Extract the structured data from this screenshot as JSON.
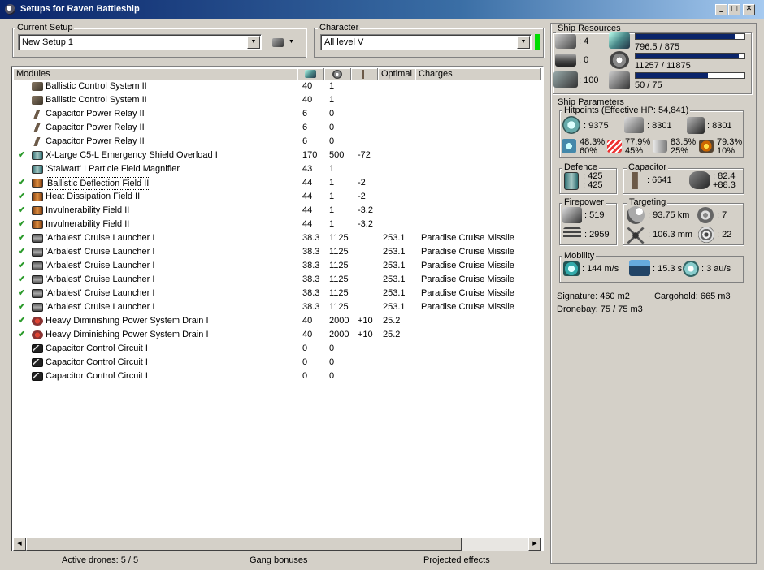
{
  "window": {
    "title": "Setups for Raven Battleship",
    "buttons": [
      "_",
      "□",
      "✕"
    ]
  },
  "current_setup": {
    "label": "Current Setup",
    "value": "New Setup 1"
  },
  "character": {
    "label": "Character",
    "value": "All level V",
    "status_color": "#00dd00"
  },
  "modules_table": {
    "headers": [
      "Modules",
      "cpu-icon",
      "powergrid-icon",
      "capacitor-icon",
      "Optimal",
      "Charges"
    ],
    "rows": [
      {
        "checked": false,
        "icon": "ic-bcs",
        "name": "Ballistic Control System II",
        "cpu": "40",
        "pg": "1",
        "cap": "",
        "optimal": "",
        "charges": ""
      },
      {
        "checked": false,
        "icon": "ic-bcs",
        "name": "Ballistic Control System II",
        "cpu": "40",
        "pg": "1",
        "cap": "",
        "optimal": "",
        "charges": ""
      },
      {
        "checked": false,
        "icon": "ic-cpr",
        "name": "Capacitor Power Relay II",
        "cpu": "6",
        "pg": "0",
        "cap": "",
        "optimal": "",
        "charges": ""
      },
      {
        "checked": false,
        "icon": "ic-cpr",
        "name": "Capacitor Power Relay II",
        "cpu": "6",
        "pg": "0",
        "cap": "",
        "optimal": "",
        "charges": ""
      },
      {
        "checked": false,
        "icon": "ic-cpr",
        "name": "Capacitor Power Relay II",
        "cpu": "6",
        "pg": "0",
        "cap": "",
        "optimal": "",
        "charges": ""
      },
      {
        "checked": true,
        "icon": "ic-shield",
        "name": "X-Large C5-L Emergency Shield Overload I",
        "cpu": "170",
        "pg": "500",
        "cap": "-72",
        "optimal": "",
        "charges": ""
      },
      {
        "checked": false,
        "icon": "ic-shield",
        "name": "'Stalwart' I Particle Field Magnifier",
        "cpu": "43",
        "pg": "1",
        "cap": "",
        "optimal": "",
        "charges": ""
      },
      {
        "checked": true,
        "icon": "ic-armor",
        "name": "Ballistic Deflection Field II",
        "cpu": "44",
        "pg": "1",
        "cap": "-2",
        "optimal": "",
        "charges": "",
        "focused": true
      },
      {
        "checked": true,
        "icon": "ic-armor",
        "name": "Heat Dissipation Field II",
        "cpu": "44",
        "pg": "1",
        "cap": "-2",
        "optimal": "",
        "charges": ""
      },
      {
        "checked": true,
        "icon": "ic-armor",
        "name": "Invulnerability Field II",
        "cpu": "44",
        "pg": "1",
        "cap": "-3.2",
        "optimal": "",
        "charges": ""
      },
      {
        "checked": true,
        "icon": "ic-armor",
        "name": "Invulnerability Field II",
        "cpu": "44",
        "pg": "1",
        "cap": "-3.2",
        "optimal": "",
        "charges": ""
      },
      {
        "checked": true,
        "icon": "ic-launch",
        "name": "'Arbalest' Cruise Launcher I",
        "cpu": "38.3",
        "pg": "1125",
        "cap": "",
        "optimal": "253.1",
        "charges": "Paradise Cruise Missile"
      },
      {
        "checked": true,
        "icon": "ic-launch",
        "name": "'Arbalest' Cruise Launcher I",
        "cpu": "38.3",
        "pg": "1125",
        "cap": "",
        "optimal": "253.1",
        "charges": "Paradise Cruise Missile"
      },
      {
        "checked": true,
        "icon": "ic-launch",
        "name": "'Arbalest' Cruise Launcher I",
        "cpu": "38.3",
        "pg": "1125",
        "cap": "",
        "optimal": "253.1",
        "charges": "Paradise Cruise Missile"
      },
      {
        "checked": true,
        "icon": "ic-launch",
        "name": "'Arbalest' Cruise Launcher I",
        "cpu": "38.3",
        "pg": "1125",
        "cap": "",
        "optimal": "253.1",
        "charges": "Paradise Cruise Missile"
      },
      {
        "checked": true,
        "icon": "ic-launch",
        "name": "'Arbalest' Cruise Launcher I",
        "cpu": "38.3",
        "pg": "1125",
        "cap": "",
        "optimal": "253.1",
        "charges": "Paradise Cruise Missile"
      },
      {
        "checked": true,
        "icon": "ic-launch",
        "name": "'Arbalest' Cruise Launcher I",
        "cpu": "38.3",
        "pg": "1125",
        "cap": "",
        "optimal": "253.1",
        "charges": "Paradise Cruise Missile"
      },
      {
        "checked": true,
        "icon": "ic-drain",
        "name": "Heavy Diminishing Power System Drain I",
        "cpu": "40",
        "pg": "2000",
        "cap": "+10",
        "optimal": "25.2",
        "charges": ""
      },
      {
        "checked": true,
        "icon": "ic-drain",
        "name": "Heavy Diminishing Power System Drain I",
        "cpu": "40",
        "pg": "2000",
        "cap": "+10",
        "optimal": "25.2",
        "charges": ""
      },
      {
        "checked": false,
        "icon": "ic-ccc",
        "name": "Capacitor Control Circuit I",
        "cpu": "0",
        "pg": "0",
        "cap": "",
        "optimal": "",
        "charges": ""
      },
      {
        "checked": false,
        "icon": "ic-ccc",
        "name": "Capacitor Control Circuit I",
        "cpu": "0",
        "pg": "0",
        "cap": "",
        "optimal": "",
        "charges": ""
      },
      {
        "checked": false,
        "icon": "ic-ccc",
        "name": "Capacitor Control Circuit I",
        "cpu": "0",
        "pg": "0",
        "cap": "",
        "optimal": "",
        "charges": ""
      }
    ]
  },
  "status_bar": {
    "drones": "Active drones: 5 / 5",
    "gang": "Gang bonuses",
    "projected": "Projected effects"
  },
  "ship_resources": {
    "label": "Ship Resources",
    "turrets": ": 4",
    "launchers": ": 0",
    "calibration": ": 100",
    "cpu": "796.5 / 875",
    "cpu_fraction": 0.91,
    "powergrid": "11257 / 11875",
    "powergrid_fraction": 0.948,
    "dronebay_bandwidth": "50 / 75",
    "dronebay_fraction": 0.667
  },
  "ship_parameters": {
    "label": "Ship Parameters",
    "hitpoints": {
      "label": "Hitpoints (Effective HP: 54,841)",
      "shield": ": 9375",
      "armor": ": 8301",
      "structure": ": 8301",
      "res": [
        {
          "top": "48.3%",
          "bottom": "60%"
        },
        {
          "top": "77.9%",
          "bottom": "45%"
        },
        {
          "top": "83.5%",
          "bottom": "25%"
        },
        {
          "top": "79.3%",
          "bottom": "10%"
        }
      ]
    },
    "defence": {
      "label": "Defence",
      "top": ": 425",
      "bottom": ": 425"
    },
    "capacitor": {
      "label": "Capacitor",
      "amount": ": 6641",
      "top": ": 82.4",
      "bottom": "+88.3"
    },
    "firepower": {
      "label": "Firepower",
      "dps": ": 519",
      "volley": ": 2959"
    },
    "targeting": {
      "label": "Targeting",
      "range": ": 93.75 km",
      "targets": ": 7",
      "scan_res": ": 106.3 mm",
      "sensor": ": 22"
    },
    "mobility": {
      "label": "Mobility",
      "speed": ": 144 m/s",
      "align": ": 15.3 s",
      "warp": ": 3 au/s"
    },
    "signature": "Signature: 460 m2",
    "cargohold": "Cargohold: 665 m3",
    "dronebay": "Dronebay: 75 / 75 m3"
  }
}
